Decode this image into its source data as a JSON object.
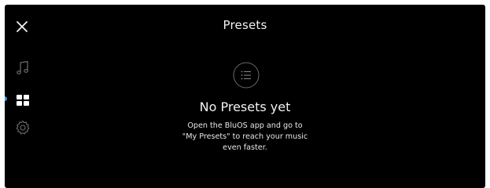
{
  "header": {
    "title": "Presets"
  },
  "sidebar": {
    "items": [
      {
        "icon": "music-note-icon"
      },
      {
        "icon": "grid-icon",
        "active": true
      },
      {
        "icon": "gear-icon"
      }
    ],
    "accent": "#3aa0d8"
  },
  "empty_state": {
    "icon": "list-icon",
    "title": "No Presets yet",
    "description_lines": [
      "Open the BluOS app and go to",
      "\"My Presets\" to reach your music",
      "even faster."
    ]
  }
}
